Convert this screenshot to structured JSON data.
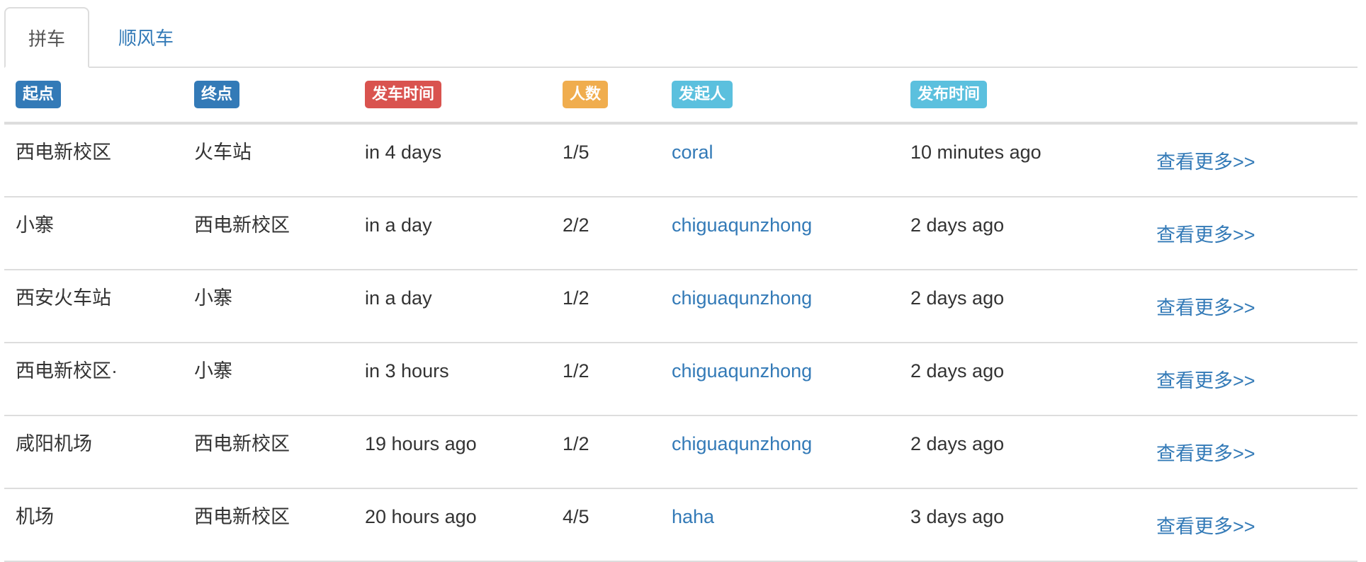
{
  "tabs": [
    {
      "label": "拼车",
      "active": true
    },
    {
      "label": "顺风车",
      "active": false
    }
  ],
  "headers": {
    "origin": {
      "label": "起点",
      "color": "#337ab7"
    },
    "destination": {
      "label": "终点",
      "color": "#337ab7"
    },
    "departure": {
      "label": "发车时间",
      "color": "#d9534f"
    },
    "seats": {
      "label": "人数",
      "color": "#f0ad4e"
    },
    "initiator": {
      "label": "发起人",
      "color": "#5bc0de"
    },
    "published": {
      "label": "发布时间",
      "color": "#5bc0de"
    }
  },
  "rows": [
    {
      "origin": "西电新校区",
      "destination": "火车站",
      "departure": "in 4 days",
      "seats": "1/5",
      "initiator": "coral",
      "published": "10 minutes ago",
      "more": "查看更多>>"
    },
    {
      "origin": "小寨",
      "destination": "西电新校区",
      "departure": "in a day",
      "seats": "2/2",
      "initiator": "chiguaqunzhong",
      "published": "2 days ago",
      "more": "查看更多>>"
    },
    {
      "origin": "西安火车站",
      "destination": "小寨",
      "departure": "in a day",
      "seats": "1/2",
      "initiator": "chiguaqunzhong",
      "published": "2 days ago",
      "more": "查看更多>>"
    },
    {
      "origin": "西电新校区·",
      "destination": "小寨",
      "departure": "in 3 hours",
      "seats": "1/2",
      "initiator": "chiguaqunzhong",
      "published": "2 days ago",
      "more": "查看更多>>"
    },
    {
      "origin": "咸阳机场",
      "destination": "西电新校区",
      "departure": "19 hours ago",
      "seats": "1/2",
      "initiator": "chiguaqunzhong",
      "published": "2 days ago",
      "more": "查看更多>>"
    },
    {
      "origin": "机场",
      "destination": "西电新校区",
      "departure": "20 hours ago",
      "seats": "4/5",
      "initiator": "haha",
      "published": "3 days ago",
      "more": "查看更多>>"
    }
  ]
}
